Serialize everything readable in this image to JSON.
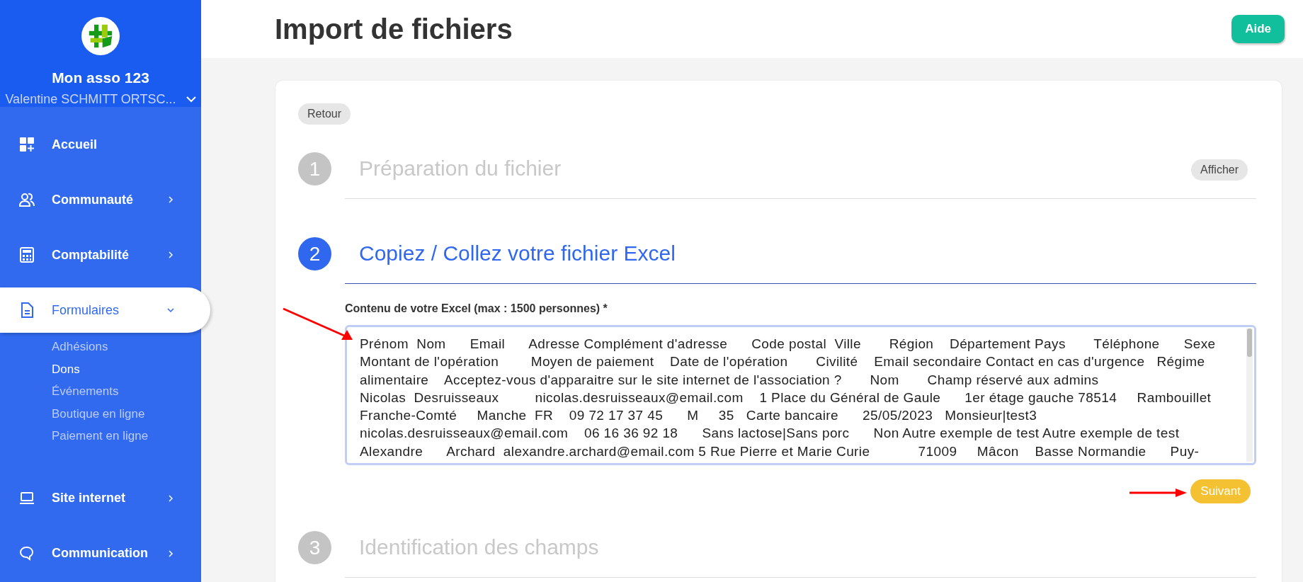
{
  "sidebar": {
    "org_name": "Mon asso 123",
    "user_name": "Valentine SCHMITT ORTSC...",
    "items": [
      {
        "label": "Accueil",
        "selected": false
      },
      {
        "label": "Communauté",
        "selected": false,
        "expanded": false
      },
      {
        "label": "Comptabilité",
        "selected": false,
        "expanded": false
      },
      {
        "label": "Formulaires",
        "selected": true,
        "expanded": true,
        "children": [
          {
            "label": "Adhésions",
            "selected": false
          },
          {
            "label": "Dons",
            "selected": true
          },
          {
            "label": "Événements",
            "selected": false
          },
          {
            "label": "Boutique en ligne",
            "selected": false
          },
          {
            "label": "Paiement en ligne",
            "selected": false
          }
        ]
      },
      {
        "label": "Site internet",
        "selected": false,
        "expanded": false
      },
      {
        "label": "Communication",
        "selected": false,
        "expanded": false
      }
    ]
  },
  "header": {
    "title": "Import de fichiers",
    "help_button": "Aide"
  },
  "back_button": "Retour",
  "steps": [
    {
      "number": "1",
      "title": "Préparation du fichier",
      "active": false,
      "button": "Afficher"
    },
    {
      "number": "2",
      "title": "Copiez / Collez votre fichier Excel",
      "active": true,
      "field_label": "Contenu de votre Excel (max : 1500 personnes) *",
      "lines": [
        "Prénom  Nom      Email      Adresse Complément d'adresse      Code postal  Ville       Région    Département Pays       Téléphone      Sexe",
        "Montant de l'opération        Moyen de paiement    Date de l'opération       Civilité    Email secondaire Contact en cas d'urgence   Régime",
        "alimentaire    Acceptez-vous d'apparaitre sur le site internet de l'association ?       Nom       Champ réservé aux admins",
        "Nicolas  Desruisseaux         nicolas.desruisseaux@email.com    1 Place du Général de Gaule      1er étage gauche 78514     Rambouillet",
        "Franche-Comté     Manche  FR    09 72 17 37 45      M     35   Carte bancaire      25/05/2023   Monsieur|test3",
        "nicolas.desruisseaux@email.com    06 16 36 92 18      Sans lactose|Sans porc      Non Autre exemple de test Autre exemple de test",
        "Alexandre      Archard  alexandre.archard@email.com 5 Rue Pierre et Marie Curie            71009     Mâcon    Basse Normandie      Puy-"
      ],
      "next_button": "Suivant"
    },
    {
      "number": "3",
      "title": "Identification des champs",
      "active": false
    }
  ]
}
